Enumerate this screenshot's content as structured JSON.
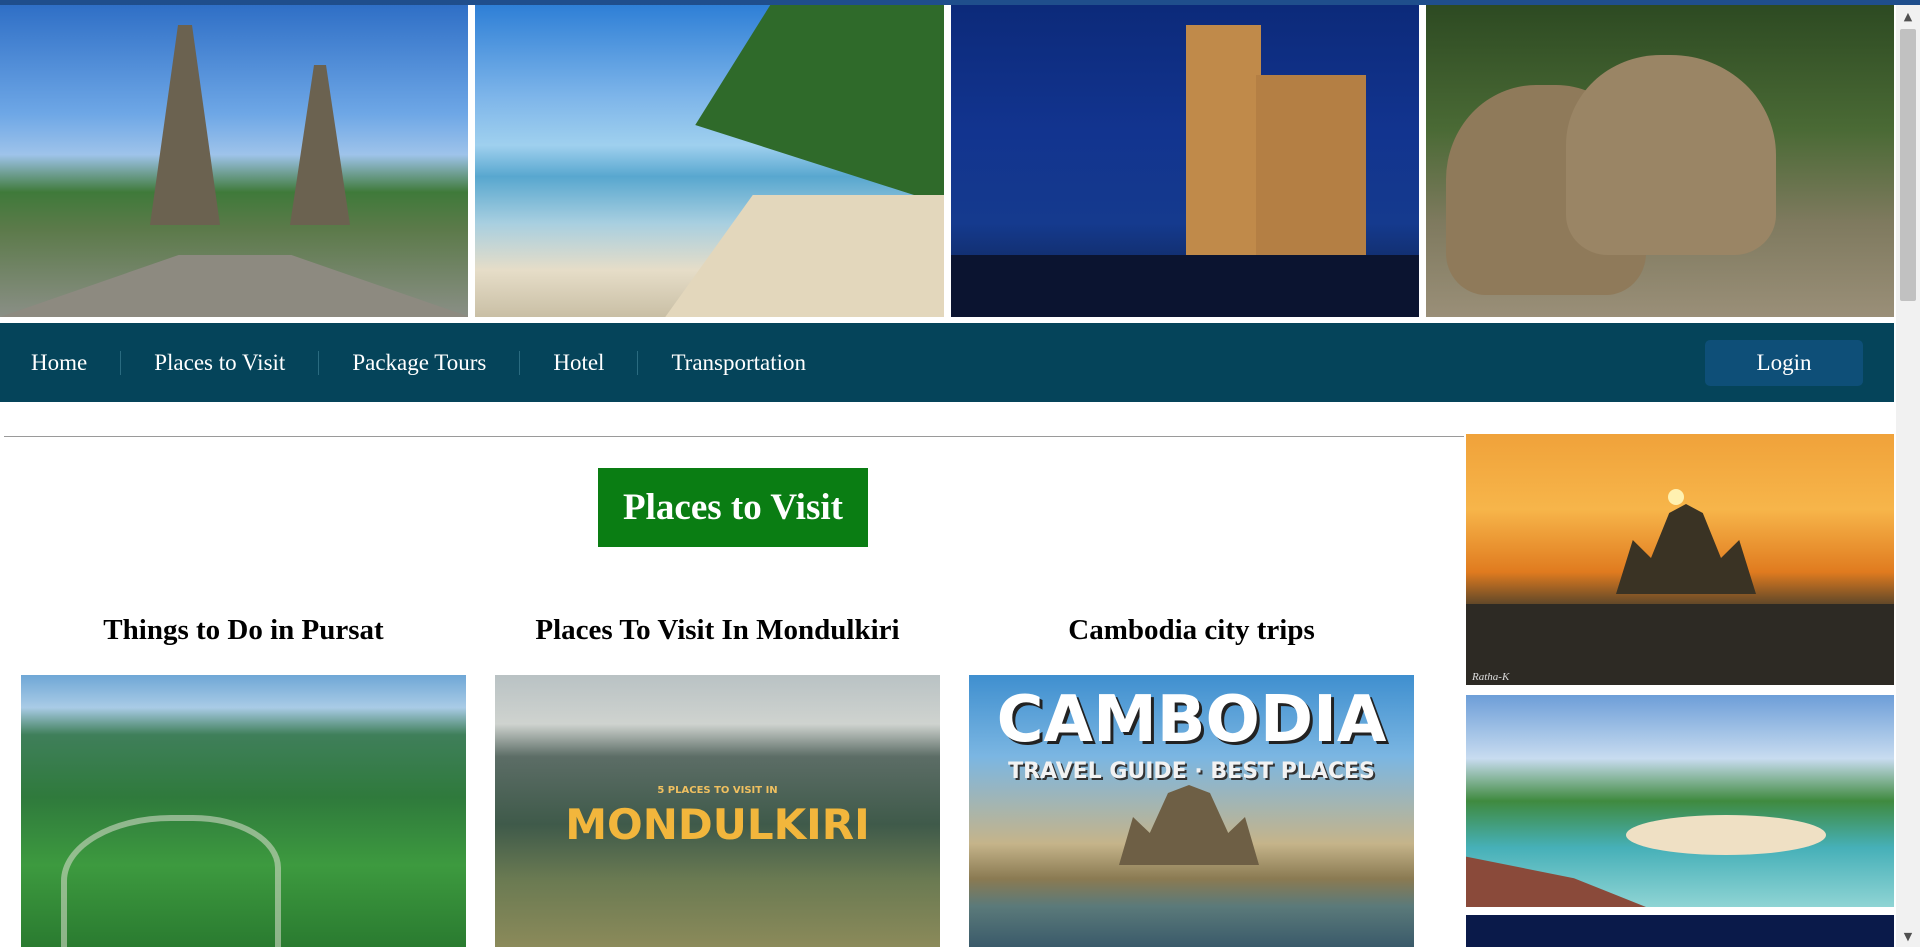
{
  "banner": {
    "photos": [
      {
        "name": "angkor-wat-photo"
      },
      {
        "name": "beach-photo"
      },
      {
        "name": "hotel-photo"
      },
      {
        "name": "elephants-photo"
      }
    ]
  },
  "nav": {
    "items": [
      "Home",
      "Places to Visit",
      "Package Tours",
      "Hotel",
      "Transportation"
    ],
    "login_label": "Login"
  },
  "main": {
    "title": "Places to Visit",
    "cards": [
      {
        "title": "Things to Do in Pursat"
      },
      {
        "title": "Places To Visit In Mondulkiri",
        "image_text_small": "5 PLACES TO VISIT IN",
        "image_text_big": "MONDULKIRI"
      },
      {
        "title": "Cambodia city trips",
        "image_text_big": "CAMBODIA",
        "image_text_sub": "TRAVEL GUIDE · BEST PLACES"
      }
    ]
  },
  "sidebar": {
    "photo1_credit": "Ratha-K"
  },
  "colors": {
    "nav_bg": "#05445a",
    "login_bg": "#0e4f78",
    "title_bg": "#0a7d13"
  }
}
